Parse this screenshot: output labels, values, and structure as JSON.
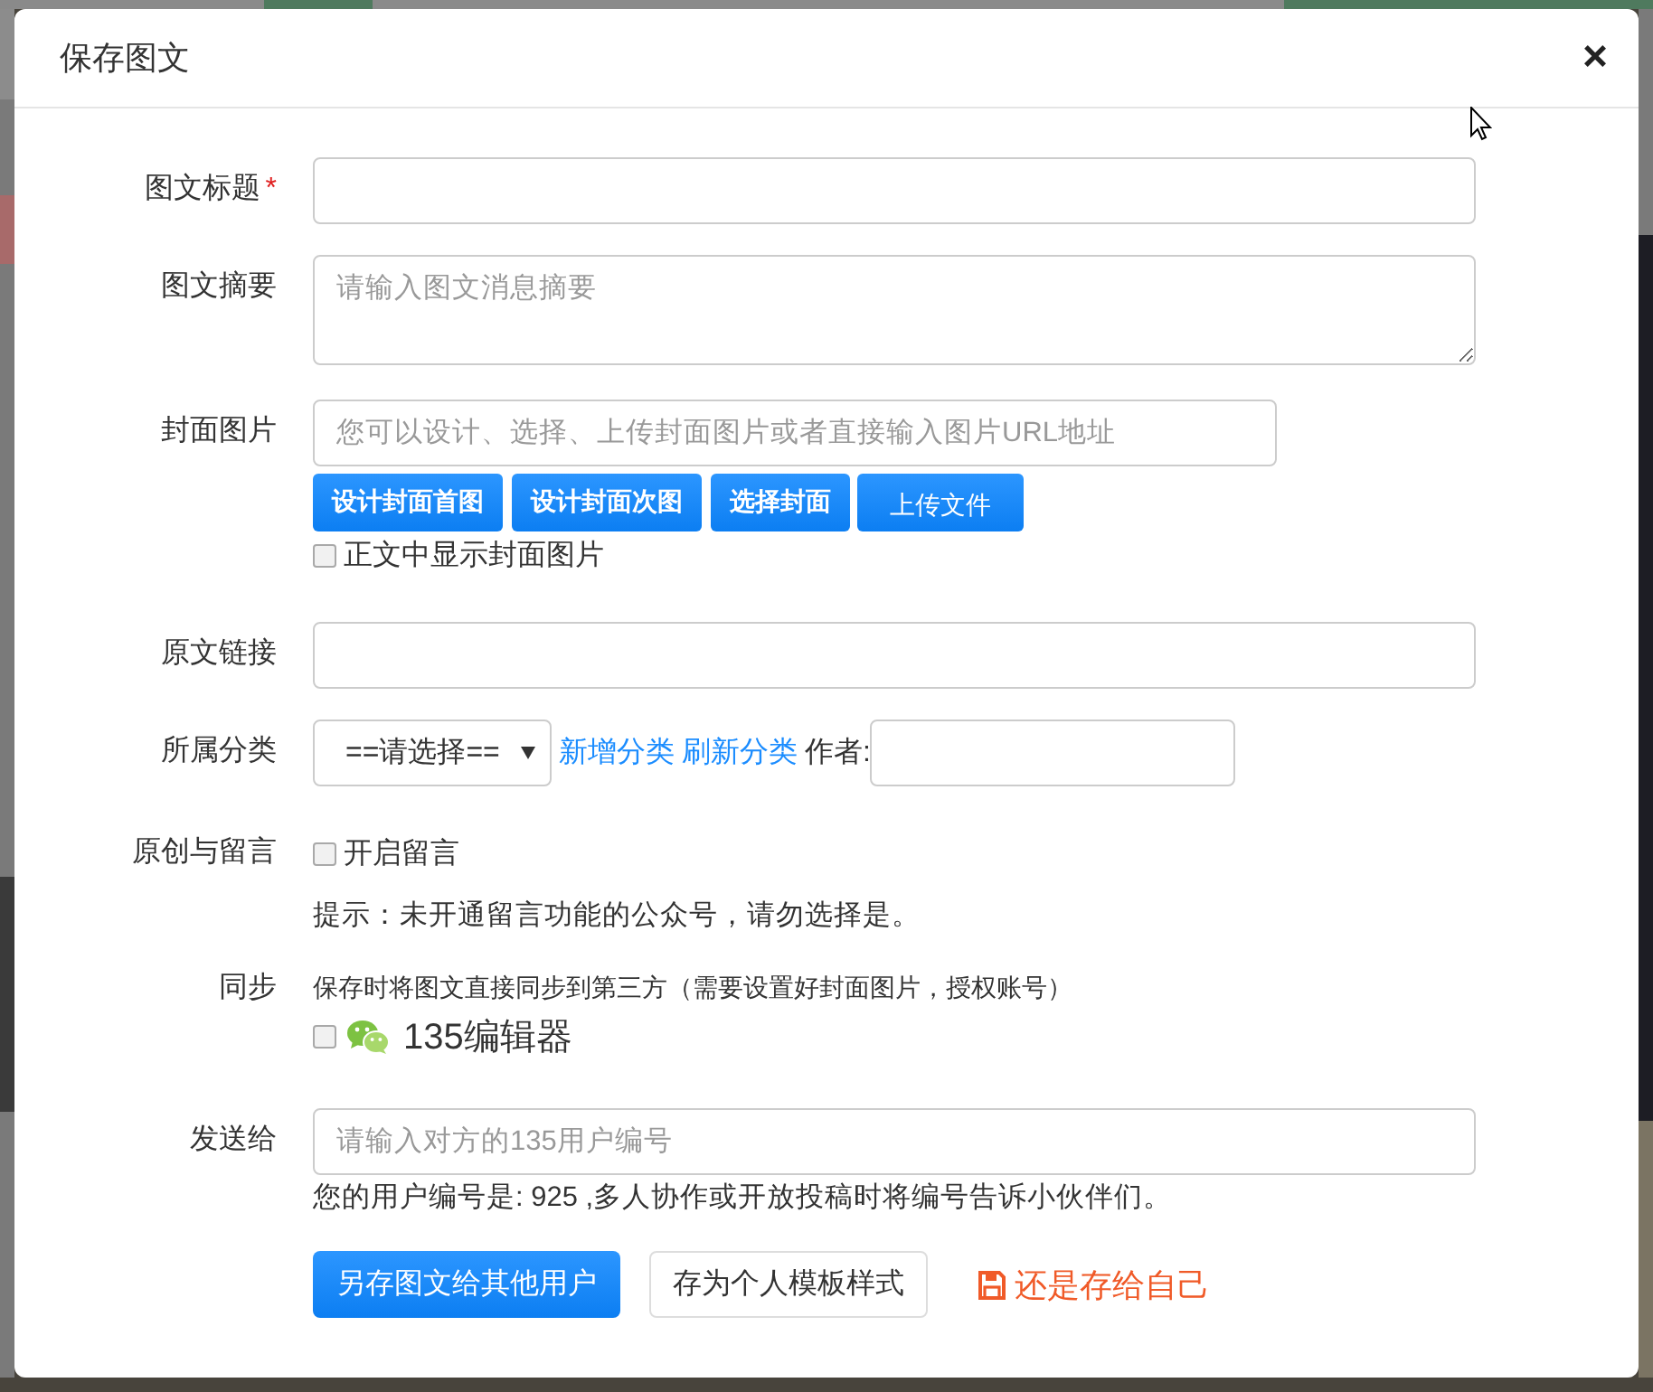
{
  "dialog": {
    "title": "保存图文",
    "close": "×"
  },
  "fields": [
    {
      "kind": "text",
      "label": "图文标题",
      "required_mark": "*"
    },
    {
      "kind": "textarea",
      "label": "图文摘要",
      "placeholder": "请输入图文消息摘要"
    },
    {
      "kind": "cover",
      "label": "封面图片",
      "placeholder": "您可以设计、选择、上传封面图片或者直接输入图片URL地址",
      "buttons": [
        {
          "kind": "action",
          "label": "设计封面首图"
        },
        {
          "kind": "action",
          "label": "设计封面次图"
        },
        {
          "kind": "action",
          "label": "选择封面"
        },
        {
          "kind": "upload",
          "label": "上传文件"
        }
      ],
      "checkbox": {
        "label": "正文中显示封面图片",
        "checked": false
      }
    },
    {
      "kind": "text",
      "label": "原文链接"
    },
    {
      "kind": "category",
      "label": "所属分类",
      "select": "==请选择==",
      "links": [
        "新增分类",
        "刷新分类"
      ],
      "author_label": "作者:"
    },
    {
      "kind": "comment",
      "label": "原创与留言",
      "checkbox": {
        "label": "开启留言",
        "checked": false
      },
      "hint": "提示：未开通留言功能的公众号，请勿选择是。"
    },
    {
      "kind": "sync",
      "label": "同步",
      "note": "保存时将图文直接同步到第三方（需要设置好封面图片，授权账号）",
      "checkbox": {
        "label": "135编辑器",
        "checked": false
      }
    },
    {
      "kind": "send",
      "label": "发送给",
      "placeholder": "请输入对方的135用户编号",
      "help": "您的用户编号是: 925 ,多人协作或开放投稿时将编号告诉小伙伴们。"
    }
  ],
  "actions": [
    {
      "kind": "primary",
      "label": "另存图文给其他用户"
    },
    {
      "kind": "default",
      "label": "存为个人模板样式"
    },
    {
      "kind": "link",
      "label": "还是存给自己"
    }
  ]
}
